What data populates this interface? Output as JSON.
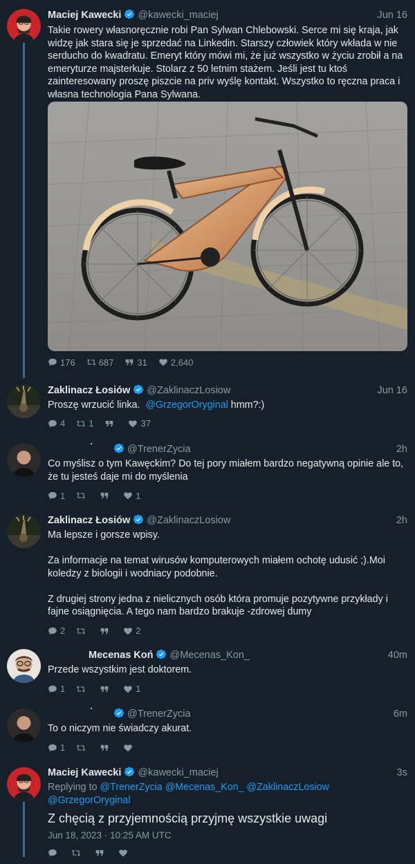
{
  "tweets": [
    {
      "name": "Maciej Kawecki",
      "handle": "@kawecki_maciej",
      "time": "Jun 16",
      "text": "Takie rowery własnoręcznie robi Pan Sylwan Chlebowski. Serce mi się kraja, jak widzę jak stara się je sprzedać na Linkedin. Starszy człowiek który wkłada w nie serducho do kwadratu. Emeryt który mówi mi, że już wszystko w życiu zrobił a na emeryturze majsterkuje. Stolarz z 50 letnim stażem. Jeśli jest tu ktoś zainteresowany proszę piszcie na priv wyślę kontakt. Wszystko to ręczna praca i własna technologia Pana Sylwana.",
      "replies": "176",
      "retweets": "687",
      "quotes": "31",
      "likes": "2,640"
    },
    {
      "name": "Zaklinacz Łosiów",
      "handle": "@ZaklinaczLosiow",
      "time": "Jun 16",
      "text_before": "Proszę wrzucić linka.  ",
      "mention": "@GrzegorOryginal",
      "text_after": " hmm?:)",
      "replies": "4",
      "retweets": "1",
      "quotes": "",
      "likes": "37"
    },
    {
      "name": "",
      "handle": "@TrenerZycia",
      "time": "2h",
      "text": "Co myślisz o tym Kawęckim? Do tej pory miałem bardzo negatywną opinie ale to, że tu jesteś daje mi do myślenia",
      "replies": "1",
      "retweets": "",
      "quotes": "",
      "likes": "1"
    },
    {
      "name": "Zaklinacz Łosiów",
      "handle": "@ZaklinaczLosiow",
      "time": "2h",
      "text": "Ma lepsze i gorsze wpisy.\n\nZa informacje na temat wirusów komputerowych miałem ochotę udusić ;).Moi koledzy z biologii i wodniacy podobnie.\n\nZ drugiej strony jedna z nielicznych osób która promuje pozytywne przykłady i fajne osiągnięcia. A tego nam bardzo brakuje -zdrowej dumy",
      "replies": "2",
      "retweets": "",
      "quotes": "",
      "likes": "2"
    },
    {
      "name": "Mecenas Koń",
      "handle": "@Mecenas_Kon_",
      "time": "40m",
      "text": "Przede wszystkim jest doktorem.",
      "replies": "1",
      "retweets": "",
      "quotes": "",
      "likes": "1"
    },
    {
      "name": "",
      "handle": "@TrenerZycia",
      "time": "6m",
      "text": "To o niczym nie świadczy akurat.",
      "replies": "1",
      "retweets": "",
      "quotes": "",
      "likes": ""
    },
    {
      "name": "Maciej Kawecki",
      "handle": "@kawecki_maciej",
      "time": "3s",
      "replying_prefix": "Replying to ",
      "replying_mentions": "@TrenerZycia @Mecenas_Kon_ @ZaklinaczLosiow",
      "replying_mentions2": "@GrzegorOryginal",
      "text": "Z chęcią z przyjemnością przyjmę wszystkie uwagi",
      "date": "Jun 18, 2023 · 10:25 AM UTC",
      "replies": "",
      "retweets": "",
      "quotes": "",
      "likes": ""
    }
  ],
  "colors": {
    "background": "#15202b",
    "text": "#e7e9ea",
    "secondary": "#8b98a5",
    "accent": "#1d9bf0",
    "thread_line": "#3a6d96"
  },
  "icons": [
    "reply-icon",
    "retweet-icon",
    "quote-icon",
    "like-icon",
    "verified-icon"
  ]
}
